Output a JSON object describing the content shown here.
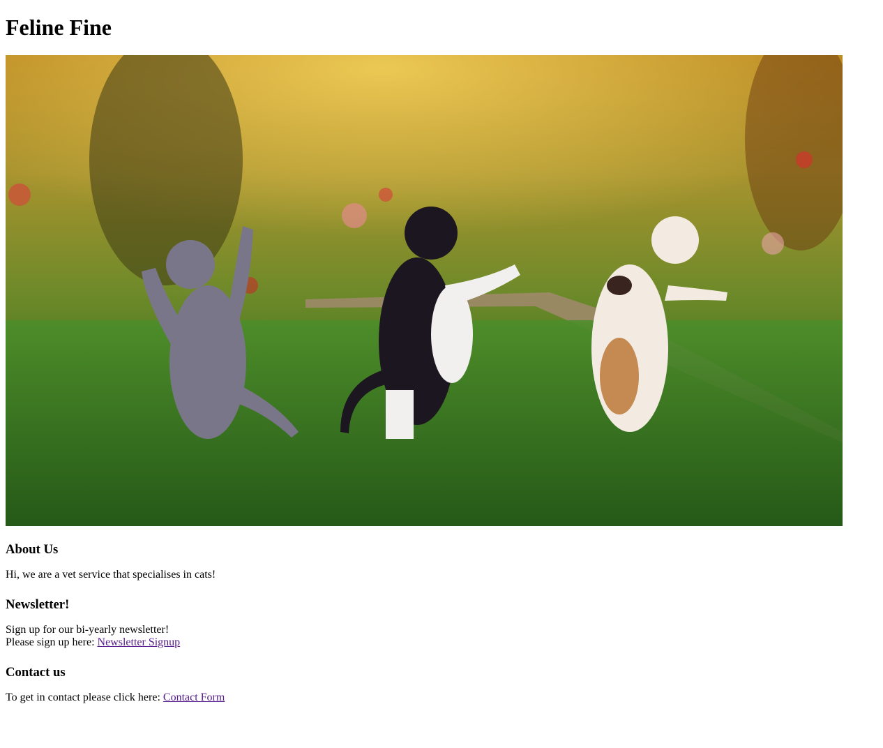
{
  "site": {
    "title": "Feline Fine",
    "hero_alt": "three kittens playing on grass"
  },
  "about": {
    "heading": "About Us",
    "text": "Hi, we are a vet service that specialises in cats!"
  },
  "newsletter": {
    "heading": "Newsletter!",
    "line1": "Sign up for our bi-yearly newsletter!",
    "line2_prefix": "Please sign up here: ",
    "link_label": "Newsletter Signup"
  },
  "contact": {
    "heading": "Contact us",
    "prefix": "To get in contact please click here: ",
    "link_label": "Contact Form"
  },
  "colors": {
    "visited_link": "#551a8b"
  }
}
